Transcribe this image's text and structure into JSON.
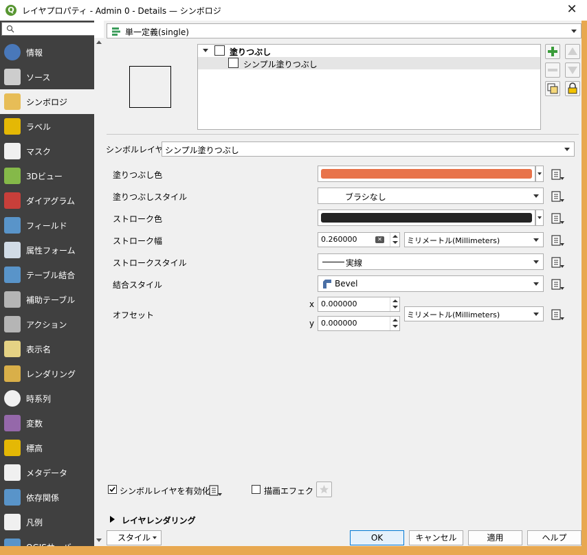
{
  "window": {
    "title": "レイヤプロパティ - Admin 0 - Details — シンボロジ",
    "app_icon": "Q"
  },
  "sidebar": {
    "search_placeholder": "",
    "items": [
      {
        "label": "情報",
        "icon": "info-icon",
        "color": "#4a7dc4"
      },
      {
        "label": "ソース",
        "icon": "settings-tools-icon",
        "color": "#d9d9d9"
      },
      {
        "label": "シンボロジ",
        "icon": "paintbrush-icon",
        "color": "#e6b84a",
        "active": true
      },
      {
        "label": "ラベル",
        "icon": "abc-label-icon",
        "color": "#f2c200"
      },
      {
        "label": "マスク",
        "icon": "abc-mask-icon",
        "color": "#ffffff"
      },
      {
        "label": "3Dビュー",
        "icon": "cube-3d-icon",
        "color": "#8bc34a"
      },
      {
        "label": "ダイアグラム",
        "icon": "diagram-icon",
        "color": "#d43f3a"
      },
      {
        "label": "フィールド",
        "icon": "fields-icon",
        "color": "#5b9bd5"
      },
      {
        "label": "属性フォーム",
        "icon": "form-icon",
        "color": "#dde8f4"
      },
      {
        "label": "テーブル結合",
        "icon": "join-icon",
        "color": "#5b9bd5"
      },
      {
        "label": "補助テーブル",
        "icon": "database-icon",
        "color": "#bfbfbf"
      },
      {
        "label": "アクション",
        "icon": "gear-action-icon",
        "color": "#bfbfbf"
      },
      {
        "label": "表示名",
        "icon": "speech-bubble-icon",
        "color": "#f3de8a"
      },
      {
        "label": "レンダリング",
        "icon": "render-brush-icon",
        "color": "#e6b84a"
      },
      {
        "label": "時系列",
        "icon": "clock-icon",
        "color": "#ffffff"
      },
      {
        "label": "変数",
        "icon": "variable-icon",
        "color": "#9c6bb3"
      },
      {
        "label": "標高",
        "icon": "elevation-icon",
        "color": "#f2c200"
      },
      {
        "label": "メタデータ",
        "icon": "metadata-icon",
        "color": "#ffffff"
      },
      {
        "label": "依存関係",
        "icon": "dependencies-icon",
        "color": "#5b9bd5"
      },
      {
        "label": "凡例",
        "icon": "legend-icon",
        "color": "#ffffff"
      },
      {
        "label": "QGISサーバ",
        "icon": "server-icon",
        "color": "#5b9bd5"
      }
    ]
  },
  "renderer": {
    "selected": "単一定義(single)"
  },
  "tree": {
    "parent": "塗りつぶし",
    "child": "シンプル塗りつぶし"
  },
  "layer_type": {
    "label": "シンボルレイヤ型",
    "value": "シンプル塗りつぶし"
  },
  "props": {
    "fill_color_label": "塗りつぶし色",
    "fill_color": "#e8734a",
    "fill_style_label": "塗りつぶしスタイル",
    "fill_style_value": "ブラシなし",
    "stroke_color_label": "ストローク色",
    "stroke_color": "#232323",
    "stroke_width_label": "ストローク幅",
    "stroke_width_value": "0.260000",
    "stroke_width_unit": "ミリメートル(Millimeters)",
    "stroke_style_label": "ストロークスタイル",
    "stroke_style_value": "実線",
    "join_style_label": "結合スタイル",
    "join_style_value": "Bevel",
    "offset_label": "オフセット",
    "offset_x_label": "x",
    "offset_x_value": "0.000000",
    "offset_y_label": "y",
    "offset_y_value": "0.000000",
    "offset_unit": "ミリメートル(Millimeters)"
  },
  "bottom": {
    "enable_layer_label": "シンボルレイヤを有効化",
    "enable_layer_checked": true,
    "draw_effects_label": "描画エフェクト",
    "draw_effects_checked": false,
    "layer_rendering_label": "レイヤレンダリング"
  },
  "footer": {
    "style_label": "スタイル",
    "ok_label": "OK",
    "cancel_label": "キャンセル",
    "apply_label": "適用",
    "help_label": "ヘルプ"
  }
}
